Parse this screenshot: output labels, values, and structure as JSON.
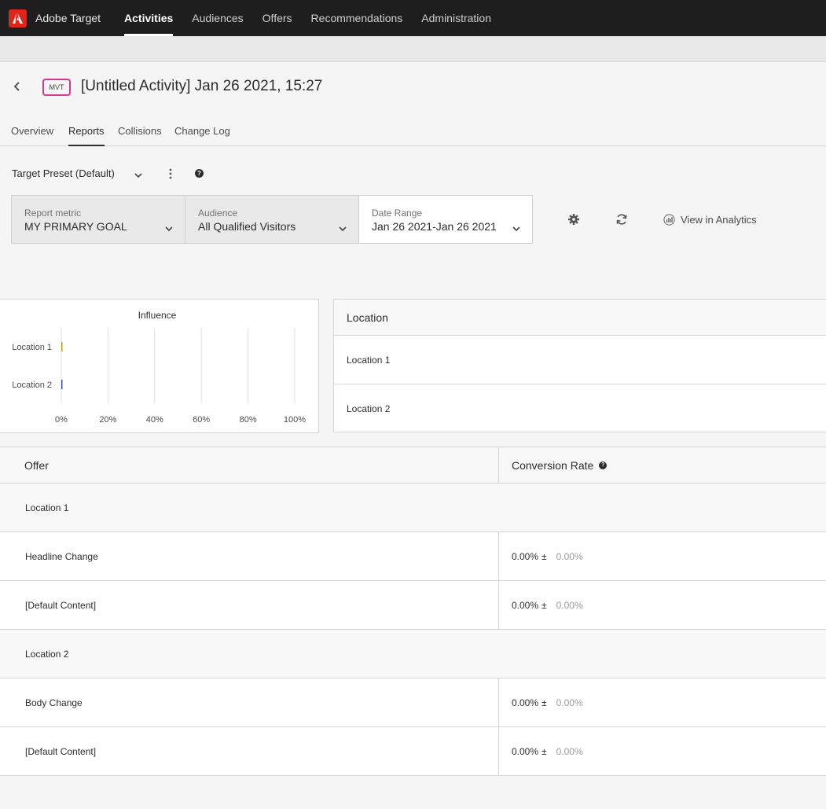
{
  "app": {
    "name": "Adobe Target",
    "nav": [
      {
        "label": "Activities",
        "active": true
      },
      {
        "label": "Audiences",
        "active": false
      },
      {
        "label": "Offers",
        "active": false
      },
      {
        "label": "Recommendations",
        "active": false
      },
      {
        "label": "Administration",
        "active": false
      }
    ]
  },
  "header": {
    "badge": "MVT",
    "title": "[Untitled Activity] Jan 26 2021, 15:27"
  },
  "tabs": [
    "Overview",
    "Reports",
    "Collisions",
    "Change Log"
  ],
  "active_tab": "Reports",
  "preset": {
    "label": "Target Preset (Default)"
  },
  "filters": {
    "metric": {
      "label": "Report metric",
      "value": "MY PRIMARY GOAL"
    },
    "audience": {
      "label": "Audience",
      "value": "All Qualified Visitors"
    },
    "date": {
      "label": "Date Range",
      "value": "Jan 26 2021-Jan 26 2021"
    }
  },
  "actions": {
    "view_analytics": "View in Analytics"
  },
  "chart_data": {
    "type": "bar",
    "title": "Influence",
    "categories": [
      "Location 1",
      "Location 2"
    ],
    "values": [
      0,
      0
    ],
    "xlim": [
      0,
      100
    ],
    "ticks": [
      "0%",
      "20%",
      "40%",
      "60%",
      "80%",
      "100%"
    ],
    "bar_colors": [
      "#b0a020",
      "#3a4fc0"
    ],
    "grid": true
  },
  "location_table": {
    "header": "Location",
    "rows": [
      "Location 1",
      "Location 2"
    ]
  },
  "offer_table": {
    "headers": {
      "offer": "Offer",
      "rate": "Conversion Rate"
    },
    "rows": [
      {
        "type": "group",
        "label": "Location 1"
      },
      {
        "type": "item",
        "label": "Headline Change",
        "rate": "0.00%",
        "pm": "±",
        "err": "0.00%"
      },
      {
        "type": "item",
        "label": "[Default Content]",
        "rate": "0.00%",
        "pm": "±",
        "err": "0.00%"
      },
      {
        "type": "group",
        "label": "Location 2"
      },
      {
        "type": "item",
        "label": "Body Change",
        "rate": "0.00%",
        "pm": "±",
        "err": "0.00%"
      },
      {
        "type": "item",
        "label": "[Default Content]",
        "rate": "0.00%",
        "pm": "±",
        "err": "0.00%"
      }
    ]
  }
}
